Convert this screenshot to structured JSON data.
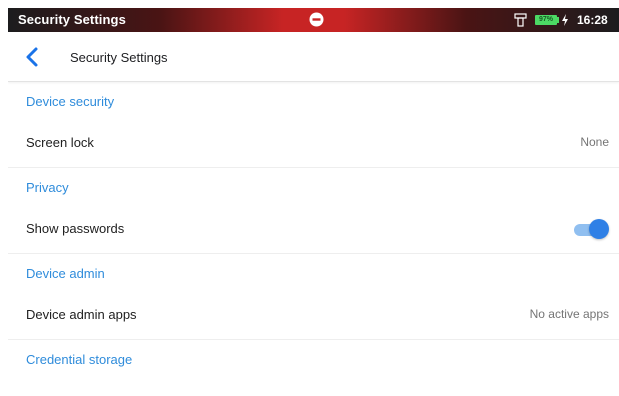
{
  "status_bar": {
    "title": "Security Settings",
    "battery_percent": "97%",
    "time": "16:28",
    "icons": [
      "do-not-disturb-icon",
      "phone-icon",
      "battery-icon",
      "charging-icon"
    ]
  },
  "toolbar": {
    "back_icon": "back-arrow-icon",
    "title": "Security Settings"
  },
  "sections": [
    {
      "header": "Device security",
      "row_label": "Screen lock",
      "row_value": "None"
    },
    {
      "header": "Privacy",
      "row_label": "Show passwords",
      "toggle_on": true
    },
    {
      "header": "Device admin",
      "row_label": "Device admin apps",
      "row_value": "No active apps"
    },
    {
      "header": "Credential storage"
    }
  ],
  "colors": {
    "accent": "#2f8cdb",
    "toggle_thumb": "#2f80e6",
    "toggle_track": "#90bff0",
    "status_red": "#c72424"
  }
}
